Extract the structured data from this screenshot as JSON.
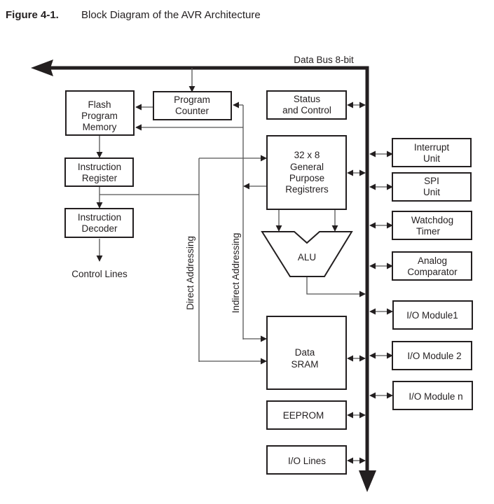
{
  "figure": {
    "number": "Figure 4-1.",
    "title": "Block Diagram of the AVR Architecture"
  },
  "bus": {
    "label": "Data Bus 8-bit"
  },
  "blocks": {
    "flash": [
      "Flash",
      "Program",
      "Memory"
    ],
    "pc": [
      "Program",
      "Counter"
    ],
    "status": [
      "Status",
      "and Control"
    ],
    "gpr": [
      "32 x 8",
      "General",
      "Purpose",
      "Registrers"
    ],
    "ir": [
      "Instruction",
      "Register"
    ],
    "id": [
      "Instruction",
      "Decoder"
    ],
    "alu": [
      "ALU"
    ],
    "sram": [
      "Data",
      "SRAM"
    ],
    "eeprom": [
      "EEPROM"
    ],
    "iolines": [
      "I/O Lines"
    ],
    "interrupt": [
      "Interrupt",
      "Unit"
    ],
    "spi": [
      "SPI",
      "Unit"
    ],
    "watchdog": [
      "Watchdog",
      "Timer"
    ],
    "analog": [
      "Analog",
      "Comparator"
    ],
    "io1": [
      "I/O Module1"
    ],
    "io2": [
      "I/O Module 2"
    ],
    "ion": [
      "I/O Module n"
    ]
  },
  "labels": {
    "control_lines": "Control Lines",
    "direct_addressing": "Direct Addressing",
    "indirect_addressing": "Indirect Addressing"
  }
}
